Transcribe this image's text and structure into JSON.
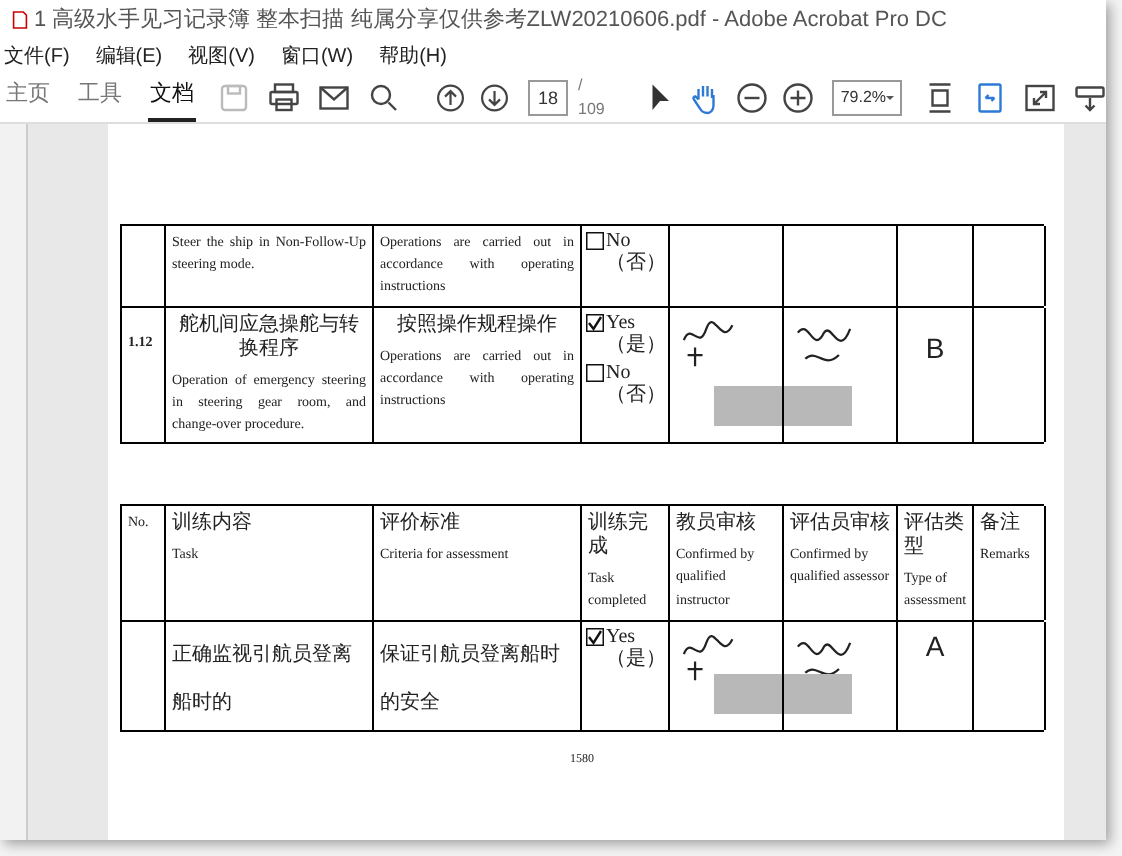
{
  "window": {
    "title": "1 高级水手见习记录簿  整本扫描  纯属分享仅供参考ZLW20210606.pdf - Adobe Acrobat Pro DC"
  },
  "menu": [
    "文件(F)",
    "编辑(E)",
    "视图(V)",
    "窗口(W)",
    "帮助(H)"
  ],
  "tabs": [
    {
      "label": "主页",
      "selected": false
    },
    {
      "label": "工具",
      "selected": false
    },
    {
      "label": "文档",
      "selected": true
    }
  ],
  "toolbar": {
    "page": "18",
    "page_count": "/ 109",
    "zoom": "79.2%",
    "tools": [
      {
        "kind": "select",
        "selected": false
      },
      {
        "kind": "hand",
        "selected": true
      }
    ]
  },
  "table_1": {
    "rows": [
      {
        "no": "",
        "task_cn": "",
        "task": [
          "Steer the ship in Non-Follow-Up steering mode."
        ],
        "criteria_cn": "",
        "criteria": [
          "Operations are carried out in accordance with operating instructions"
        ],
        "completed": [
          {
            "label": "No（否）",
            "checked": false
          }
        ],
        "instructor": {
          "signed": false,
          "redacted": false
        },
        "assessor": {
          "signed": false,
          "redacted": false
        },
        "type": "",
        "remarks": ""
      },
      {
        "no": "1.12",
        "task_cn": "舵机间应急操舵与转换程序",
        "task": [
          "Operation of emergency steering in steering gear room, and change-over procedure."
        ],
        "criteria_cn": "按照操作规程操作",
        "criteria": [
          "Operations are carried out in accordance with operating instructions"
        ],
        "completed": [
          {
            "label": "Yes（是）",
            "checked": true
          },
          {
            "label": "No（否）",
            "checked": false
          }
        ],
        "instructor": {
          "signed": true,
          "redacted": true
        },
        "assessor": {
          "signed": true,
          "redacted": true
        },
        "type": "B",
        "remarks": ""
      }
    ]
  },
  "table_2": {
    "header": {
      "no": "No.",
      "task_cn": "训练内容",
      "task": "Task",
      "criteria_cn": "评价标准",
      "criteria": "Criteria for assessment",
      "completed_cn": "训练完成",
      "completed": "Task completed",
      "instructor_cn": "教员审核",
      "instructor": "Confirmed by qualified instructor",
      "assessor_cn": "评估员审核",
      "assessor": "Confirmed by qualified assessor",
      "type_cn": "评估类型",
      "type": "Type of assessment",
      "remarks_cn": "备注",
      "remarks": "Remarks"
    },
    "rows": [
      {
        "task_cn": "正确监视引航员登离船时的",
        "criteria_cn": "保证引航员登离船时的安全",
        "completed": [
          {
            "label": "Yes（是）",
            "checked": true
          }
        ],
        "instructor": {
          "signed": true,
          "redacted": true
        },
        "assessor": {
          "signed": true,
          "redacted": true
        },
        "type": "A"
      }
    ]
  },
  "page_number": "1580"
}
